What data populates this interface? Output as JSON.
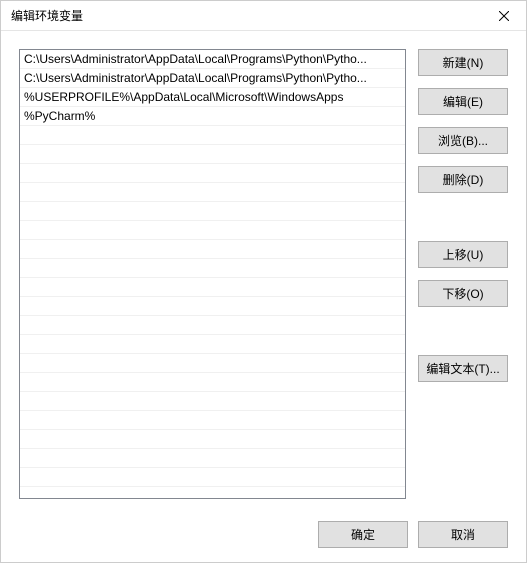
{
  "window": {
    "title": "编辑环境变量"
  },
  "list": {
    "items": [
      "C:\\Users\\Administrator\\AppData\\Local\\Programs\\Python\\Pytho...",
      "C:\\Users\\Administrator\\AppData\\Local\\Programs\\Python\\Pytho...",
      "%USERPROFILE%\\AppData\\Local\\Microsoft\\WindowsApps",
      "%PyCharm%"
    ]
  },
  "buttons": {
    "new": "新建(N)",
    "edit": "编辑(E)",
    "browse": "浏览(B)...",
    "delete": "删除(D)",
    "up": "上移(U)",
    "down": "下移(O)",
    "editText": "编辑文本(T)...",
    "ok": "确定",
    "cancel": "取消"
  }
}
